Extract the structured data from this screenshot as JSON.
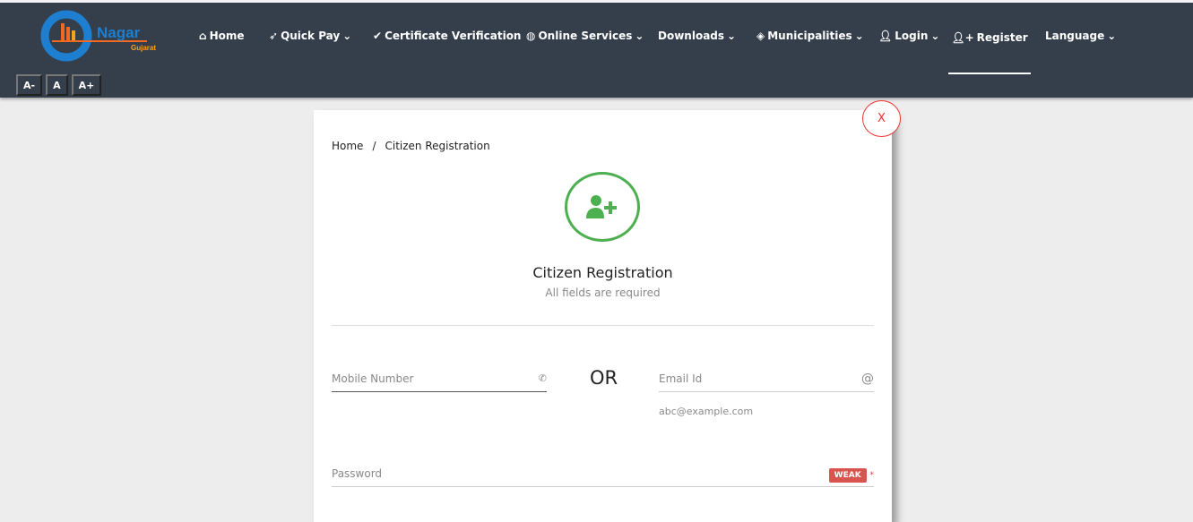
{
  "header": {
    "logo_text": "Nagar Gujarat",
    "menu": [
      {
        "label": "Home",
        "icon": "home-icon",
        "dropdown": false
      },
      {
        "label": "Quick Pay",
        "icon": "rocket-icon",
        "dropdown": true
      },
      {
        "label": "Certificate Verification",
        "icon": "check-icon",
        "dropdown": false
      },
      {
        "label": "Online Services",
        "icon": "globe-icon",
        "dropdown": true
      },
      {
        "label": "Downloads",
        "icon": "",
        "dropdown": true
      },
      {
        "label": "Municipalities",
        "icon": "tag-icon",
        "dropdown": true
      },
      {
        "label": "Login",
        "icon": "user-icon",
        "dropdown": true
      },
      {
        "label": "Register",
        "icon": "user-plus-icon",
        "dropdown": false,
        "active": true
      },
      {
        "label": "Language",
        "icon": "",
        "dropdown": true
      }
    ],
    "font_buttons": [
      "A-",
      "A",
      "A+"
    ]
  },
  "card": {
    "close_label": "X",
    "breadcrumb": [
      "Home",
      "/",
      "Citizen Registration"
    ],
    "title": "Citizen Registration",
    "subtitle": "All fields are required",
    "mobile_placeholder": "Mobile Number",
    "or_label": "OR",
    "email_placeholder": "Email Id",
    "email_hint": "abc@example.com",
    "password_placeholder": "Password",
    "strength": "WEAK",
    "required_mark": "*"
  },
  "colors": {
    "nav_bg": "#353f4c",
    "accent_green": "#4caf50",
    "weak_red": "#d9534f"
  }
}
